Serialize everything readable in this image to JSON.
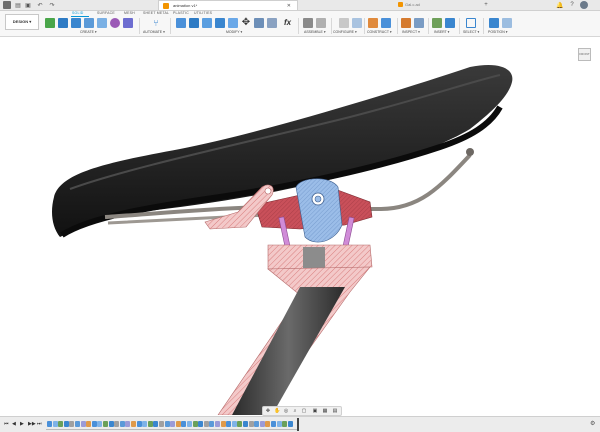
{
  "app": {
    "document_tab_title": "animation v1*",
    "second_tab_title": "Gal.c.ad"
  },
  "workspace": {
    "mode_label": "DESIGN ▾",
    "tabs": [
      "SOLID",
      "SURFACE",
      "MESH",
      "SHEET METAL",
      "PLASTIC",
      "UTILITIES"
    ],
    "active_tab": "SOLID"
  },
  "toolbar": {
    "groups": [
      {
        "label": "CREATE ▾"
      },
      {
        "label": "AUTOMATE ▾"
      },
      {
        "label": "MODIFY ▾"
      },
      {
        "label": "ASSEMBLE ▾"
      },
      {
        "label": "CONFIGURE ▾"
      },
      {
        "label": "CONSTRUCT ▾"
      },
      {
        "label": "INSPECT ▾"
      },
      {
        "label": "INSERT ▾"
      },
      {
        "label": "SELECT ▾"
      },
      {
        "label": "POSITION ▾"
      }
    ],
    "modify_fx_glyph": "fx"
  },
  "viewport": {
    "viewcube_label": "FRONT",
    "model_colors": {
      "saddle": "#1d1d1d",
      "rails": "#8b8680",
      "clamp_blue": "#8fb4e6",
      "clamp_red": "#c44a52",
      "post_section": "#f2c7c7",
      "lever_pink": "#e7b8b8",
      "bolts": "#d08bd8"
    }
  },
  "navbar": {
    "icons": [
      "orbit-icon",
      "pan-icon",
      "look-at-icon",
      "zoom-icon",
      "fit-icon",
      "display-settings-icon",
      "grid-settings-icon",
      "viewports-icon"
    ]
  },
  "timeline": {
    "controls": [
      "⏮",
      "◀",
      "▶",
      "▶▶",
      "⏭"
    ],
    "feature_count": 44
  }
}
